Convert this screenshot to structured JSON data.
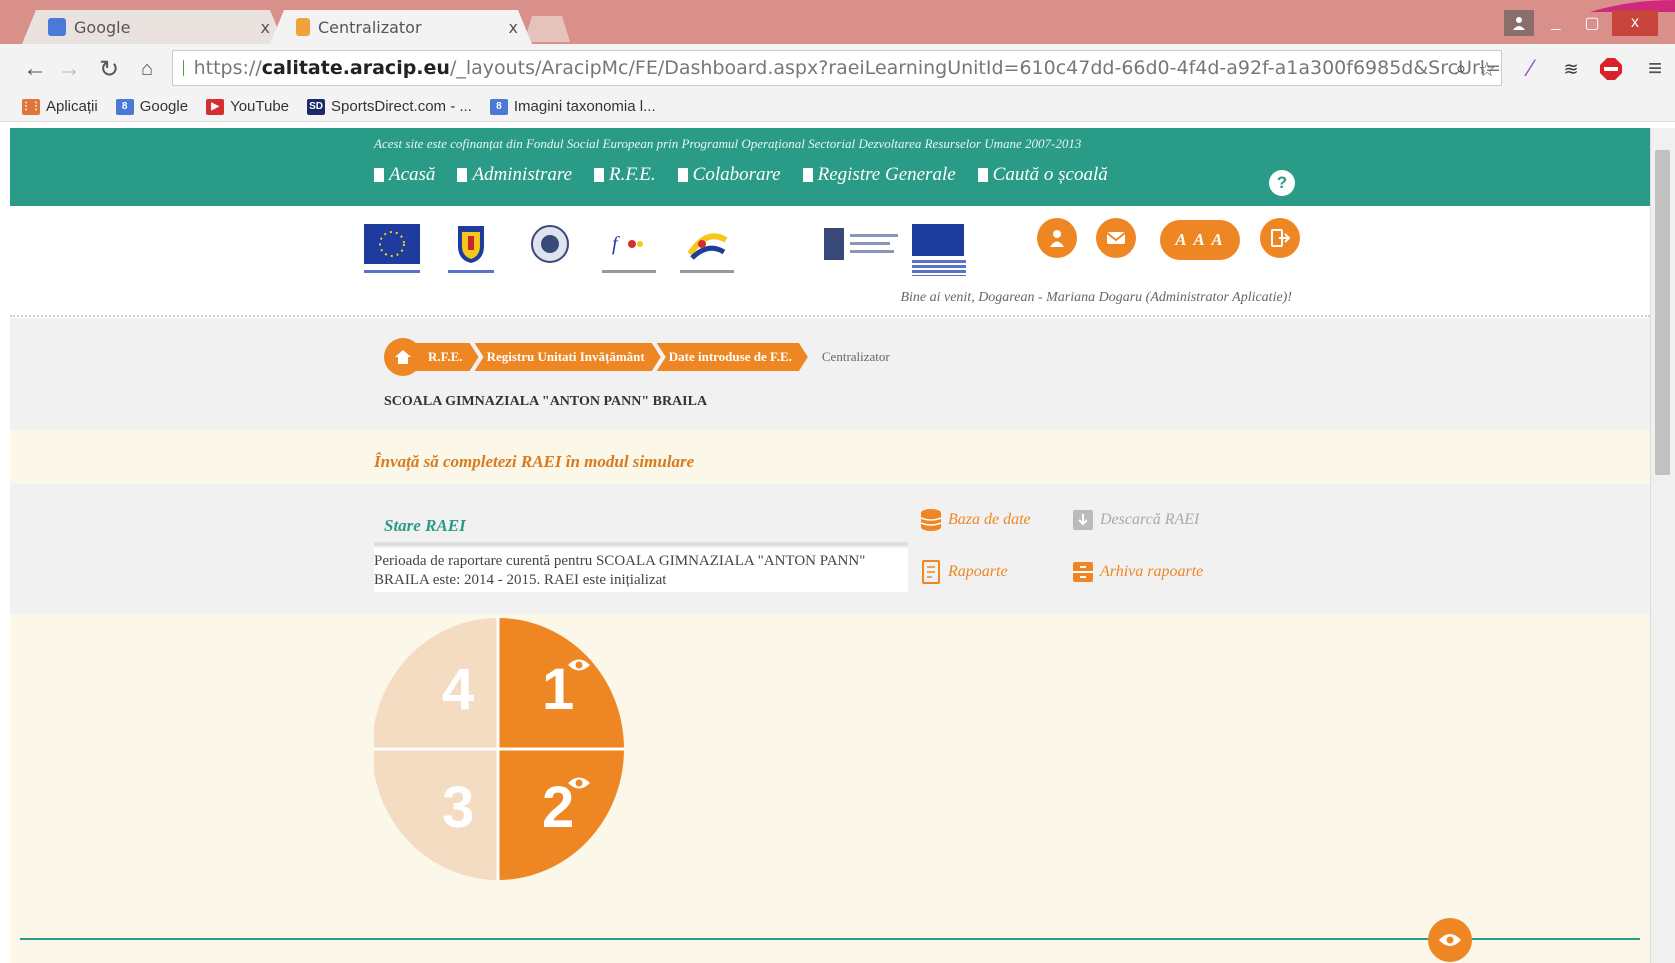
{
  "browser": {
    "tabs": [
      {
        "title": "Google",
        "favicon_color": "#4a79d8"
      },
      {
        "title": "Centralizator",
        "favicon_color": "#f0a23a"
      }
    ],
    "tab_close_glyph": "x",
    "url": {
      "scheme": "https://",
      "host": "calitate.aracip.eu",
      "path": "/_layouts/AracipMc/FE/Dashboard.aspx?raeiLearningUnitId=610c47dd-66d0-4f4d-a92f-a1a300f6985d&SrcUrl="
    },
    "window_controls": [
      "_",
      "▢",
      "x"
    ],
    "bookmarks": [
      {
        "label": "Aplicații",
        "icon": "apps-grid-icon",
        "color": "#e0773a"
      },
      {
        "label": "Google",
        "icon": "google-icon",
        "color": "#4a79d8"
      },
      {
        "label": "YouTube",
        "icon": "youtube-icon",
        "color": "#d32f2f"
      },
      {
        "label": "SportsDirect.com - ...",
        "icon": "sportsdirect-icon",
        "color": "#1a2a6c"
      },
      {
        "label": "Imagini taxonomia l...",
        "icon": "google-icon",
        "color": "#4a79d8"
      }
    ]
  },
  "site": {
    "eu_notice": "Acest site este cofinanțat din Fondul Social European prin Programul Operațional Sectorial Dezvoltarea Resurselor Umane 2007-2013",
    "nav": [
      "Acasă",
      "Administrare",
      "R.F.E.",
      "Colaborare",
      "Registre Generale",
      "Caută o școală"
    ],
    "help_glyph": "?",
    "font_size_label": "A A A",
    "welcome": "Bine ai venit, Dogarean - Mariana Dogaru (Administrator Aplicatie)!",
    "breadcrumb": [
      "R.F.E.",
      "Registru Unitati Invățământ",
      "Date introduse de F.E."
    ],
    "breadcrumb_current": "Centralizator",
    "school": "SCOALA GIMNAZIALA \"ANTON PANN\" BRAILA",
    "learn_link": "Învață să completezi RAEI în modul simulare",
    "status": {
      "title": "Stare RAEI",
      "text": "Perioada de raportare curentă pentru SCOALA GIMNAZIALA \"ANTON PANN\" BRAILA este: 2014 - 2015. RAEI este inițializat"
    },
    "actions": {
      "database": "Baza de date",
      "download": "Descarcă RAEI",
      "reports": "Rapoarte",
      "archive": "Arhiva rapoarte"
    },
    "colors": {
      "teal": "#2a9b86",
      "orange": "#ee8723",
      "pale_orange": "#f4dcc2",
      "cream": "#fbf7e9"
    }
  },
  "chart_data": {
    "type": "quadrant-selector",
    "segments": [
      {
        "label": "1",
        "state": "active",
        "has_eye": true
      },
      {
        "label": "2",
        "state": "active",
        "has_eye": true
      },
      {
        "label": "3",
        "state": "inactive",
        "has_eye": false
      },
      {
        "label": "4",
        "state": "inactive",
        "has_eye": false
      }
    ]
  }
}
